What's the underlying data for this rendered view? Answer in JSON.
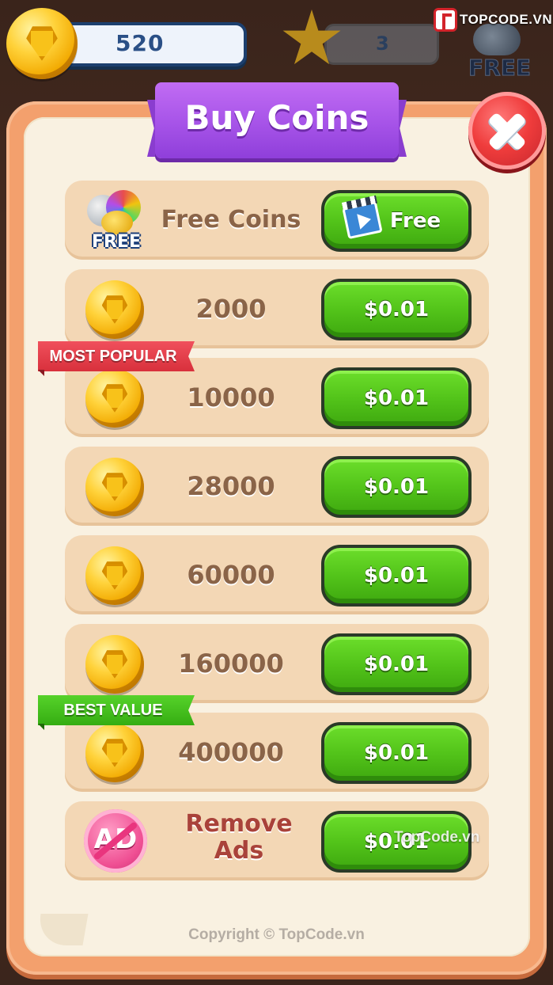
{
  "hud": {
    "coins": "520",
    "stars": "3",
    "free_label": "FREE",
    "watermark": "TOPCODE.VN"
  },
  "dialog": {
    "title": "Buy Coins",
    "close_icon": "close-icon"
  },
  "free_row": {
    "icon_label": "FREE",
    "label": "Free Coins",
    "button_label": "Free",
    "button_icon": "video-clapper-icon"
  },
  "packs": [
    {
      "amount": "2000",
      "price": "$0.01"
    },
    {
      "amount": "10000",
      "price": "$0.01"
    },
    {
      "amount": "28000",
      "price": "$0.01"
    },
    {
      "amount": "60000",
      "price": "$0.01"
    },
    {
      "amount": "160000",
      "price": "$0.01"
    },
    {
      "amount": "400000",
      "price": "$0.01"
    }
  ],
  "tags": {
    "most_popular": "MOST POPULAR",
    "best_value": "BEST VALUE"
  },
  "remove_ads": {
    "icon_text": "AD",
    "label_line1": "Remove",
    "label_line2": "Ads",
    "price": "$0.01"
  },
  "footer": {
    "copyright": "Copyright © TopCode.vn",
    "watermark": "TopCode.vn"
  },
  "colors": {
    "panel_border": "#f3a06d",
    "panel_bg": "#f9f1e1",
    "row_bg": "#f3d7b5",
    "buy_button": "#53c41a",
    "title_ribbon": "#a653e8",
    "close_button": "#ef3c3c",
    "tag_most_popular": "#e23a46",
    "tag_best_value": "#44c01e"
  }
}
